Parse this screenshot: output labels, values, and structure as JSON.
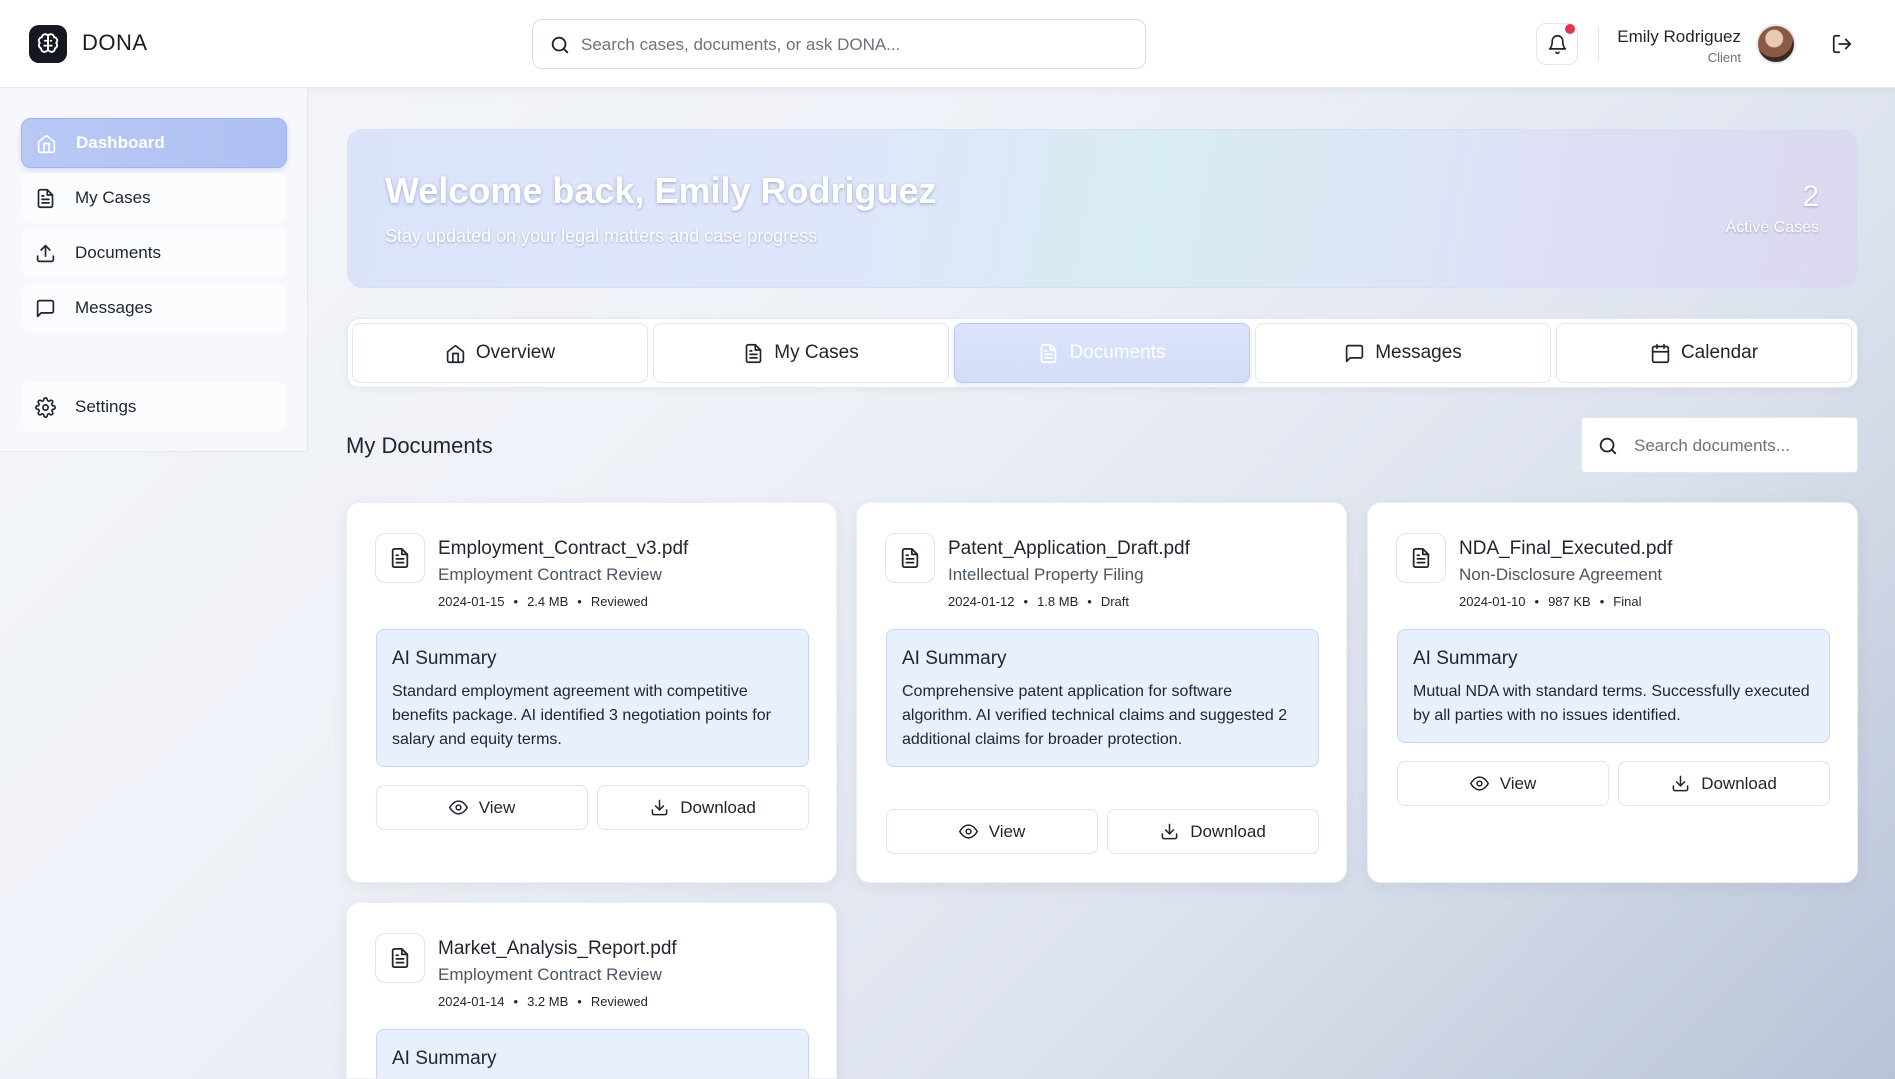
{
  "app": {
    "name": "DONA"
  },
  "header": {
    "search_placeholder": "Search cases, documents, or ask DONA...",
    "user": {
      "name": "Emily Rodriguez",
      "role": "Client"
    }
  },
  "sidebar": {
    "items": [
      {
        "label": "Dashboard",
        "icon": "home-icon",
        "active": true
      },
      {
        "label": "My Cases",
        "icon": "file-text-icon"
      },
      {
        "label": "Documents",
        "icon": "upload-icon"
      },
      {
        "label": "Messages",
        "icon": "message-square-icon"
      },
      {
        "label": "Settings",
        "icon": "gear-icon"
      }
    ]
  },
  "banner": {
    "title": "Welcome back, Emily Rodriguez",
    "subtitle": "Stay updated on your legal matters and case progress",
    "active_cases_count": "2",
    "active_cases_label": "Active Cases"
  },
  "tabs": [
    {
      "label": "Overview",
      "icon": "home-icon"
    },
    {
      "label": "My Cases",
      "icon": "file-text-icon"
    },
    {
      "label": "Documents",
      "icon": "file-text-icon",
      "active": true
    },
    {
      "label": "Messages",
      "icon": "message-square-icon"
    },
    {
      "label": "Calendar",
      "icon": "calendar-icon"
    }
  ],
  "documents_section": {
    "title": "My Documents",
    "search_placeholder": "Search documents..."
  },
  "documents": [
    {
      "name": "Employment_Contract_v3.pdf",
      "type": "Employment Contract Review",
      "date": "2024-01-15",
      "size": "2.4 MB",
      "status": "Reviewed",
      "summary_title": "AI Summary",
      "summary": "Standard employment agreement with competitive benefits package. AI identified 3 negotiation points for salary and equity terms.",
      "view_label": "View",
      "download_label": "Download"
    },
    {
      "name": "Patent_Application_Draft.pdf",
      "type": "Intellectual Property Filing",
      "date": "2024-01-12",
      "size": "1.8 MB",
      "status": "Draft",
      "summary_title": "AI Summary",
      "summary": "Comprehensive patent application for software algorithm. AI verified technical claims and suggested 2 additional claims for broader protection.",
      "view_label": "View",
      "download_label": "Download"
    },
    {
      "name": "NDA_Final_Executed.pdf",
      "type": "Non-Disclosure Agreement",
      "date": "2024-01-10",
      "size": "987 KB",
      "status": "Final",
      "summary_title": "AI Summary",
      "summary": "Mutual NDA with standard terms. Successfully executed by all parties with no issues identified.",
      "view_label": "View",
      "download_label": "Download"
    },
    {
      "name": "Market_Analysis_Report.pdf",
      "type": "Employment Contract Review",
      "date": "2024-01-14",
      "size": "3.2 MB",
      "status": "Reviewed",
      "summary_title": "AI Summary"
    }
  ],
  "colors": {
    "accent": "#aebff2",
    "summary_bg": "#e8effd",
    "notification": "#e2364a",
    "logo_bg": "#141821"
  }
}
